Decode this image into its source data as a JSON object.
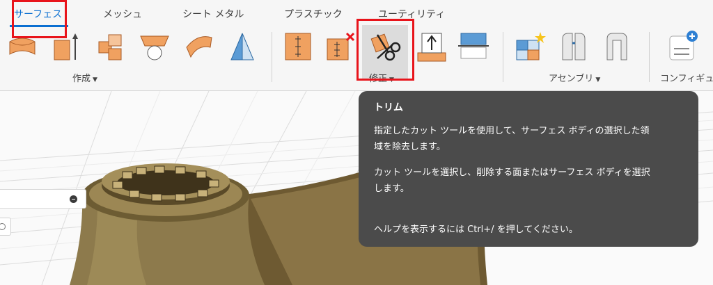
{
  "tabs": [
    {
      "label": "サーフェス",
      "active": true
    },
    {
      "label": "メッシュ"
    },
    {
      "label": "シート メタル"
    },
    {
      "label": "プラスチック"
    },
    {
      "label": "ユーティリティ"
    }
  ],
  "groups": {
    "create": "作成",
    "modify": "修正",
    "assemble": "アセンブリ",
    "configure": "コンフィギュレ"
  },
  "caret": "▼",
  "tooltip": {
    "title": "トリム",
    "line1": "指定したカット ツールを使用して、サーフェス ボディの選択した領",
    "line2": "域を除去します。",
    "line3": "カット ツールを選択し、削除する面またはサーフェス ボディを選択",
    "line4": "します。",
    "help": "ヘルプを表示するには Ctrl+/ を押してください。"
  },
  "colors": {
    "accent": "#0a6fd1",
    "highlight_box": "#e8141b",
    "tooltip_bg": "#4b4b4b",
    "icon_orange": "#f0a160",
    "icon_blue": "#5b9bd5"
  },
  "icons": [
    "extrude-icon",
    "revolve-icon",
    "patch-icon",
    "loft-icon",
    "sweep-icon",
    "ruled-icon",
    "thicken-icon",
    "offset-icon",
    "trim-icon",
    "untrim-icon",
    "extend-icon",
    "new-component-icon",
    "joint-icon",
    "as-built-joint-icon",
    "configure-icon"
  ]
}
